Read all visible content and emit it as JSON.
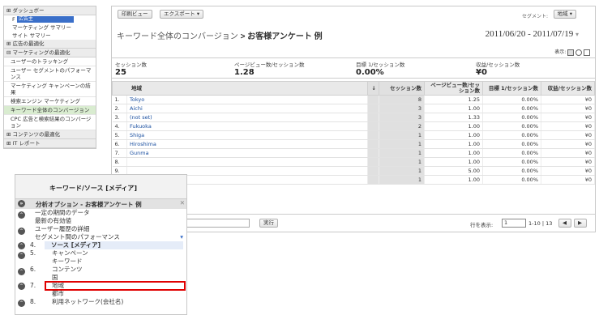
{
  "sidebar": {
    "dashboard": "ダッシュボー",
    "select_value": "広告主",
    "marketing_summary": "マーケティング サマリー",
    "site_summary": "サイト サマリー",
    "ad_optimization": "広告の最適化",
    "marketing_optimization": "マーケティングの最適化",
    "user_tracking": "ユーザーのトラッキング",
    "segment_performance": "ユーザー セグメントのパフォーマンス",
    "campaign_results": "マーケティング キャンペーンの結果",
    "search_marketing": "検索エンジン マーケティング",
    "keyword_conversion": "キーワード全体のコンバージョン",
    "cpc_comparison": "CPC 広告と検索結果のコンバージョン",
    "content_optimization": "コンテンツの最適化",
    "it_report": "IT レポート"
  },
  "toolbar": {
    "print": "印刷ビュー",
    "export": "エクスポート ▾",
    "segment_label": "セグメント:",
    "segment_value": "地域 ▾"
  },
  "title": {
    "part1": "キーワード全体のコンバージョン",
    "sep": " > ",
    "part2": "お客様アンケート 例"
  },
  "daterange": "2011/06/20 - 2011/07/19",
  "display_label": "表示:",
  "summary": [
    {
      "label": "セッション数",
      "value": "25"
    },
    {
      "label": "ページビュー数/セッション数",
      "value": "1.28"
    },
    {
      "label": "目標 1/セッション数",
      "value": "0.00%"
    },
    {
      "label": "収益/セッション数",
      "value": "¥0"
    }
  ],
  "table": {
    "headers": [
      "地域",
      "↓",
      "セッション数",
      "ページビュー数/セッション数",
      "目標 1/セッション数",
      "収益/セッション数"
    ],
    "rows": [
      [
        "1.",
        "Tokyo",
        "8",
        "1.25",
        "0.00%",
        "¥0"
      ],
      [
        "2.",
        "Aichi",
        "3",
        "1.00",
        "0.00%",
        "¥0"
      ],
      [
        "3.",
        "(not set)",
        "3",
        "1.33",
        "0.00%",
        "¥0"
      ],
      [
        "4.",
        "Fukuoka",
        "2",
        "1.00",
        "0.00%",
        "¥0"
      ],
      [
        "5.",
        "Shiga",
        "1",
        "1.00",
        "0.00%",
        "¥0"
      ],
      [
        "6.",
        "Hiroshima",
        "1",
        "1.00",
        "0.00%",
        "¥0"
      ],
      [
        "7.",
        "Gunma",
        "1",
        "1.00",
        "0.00%",
        "¥0"
      ],
      [
        "8.",
        "",
        "1",
        "1.00",
        "0.00%",
        "¥0"
      ],
      [
        "9.",
        "",
        "1",
        "5.00",
        "0.00%",
        "¥0"
      ],
      [
        "10.",
        "",
        "1",
        "1.00",
        "0.00%",
        "¥0"
      ]
    ]
  },
  "footer": {
    "run": "実行",
    "rows_label": "行を表示:",
    "rows_value": "1",
    "range": "1-10 | 13"
  },
  "popup": {
    "header": "キーワード/ソース [メディア]",
    "sub": "分析オプション - お客様アンケート 例",
    "items": [
      "一定の期間のデータ",
      "最新の有効値",
      "ユーザー履歴の詳細",
      "セグメント間のパフォーマンス"
    ],
    "n4": "4.",
    "source": "ソース [メディア]",
    "n5": "5.",
    "campaign": "キャンペーン",
    "keyword": "キーワード",
    "n6": "6.",
    "content": "コンテンツ",
    "country": "国",
    "n7": "7.",
    "region": "地域",
    "city": "都市",
    "n8": "8.",
    "network": "利用ネットワーク(会社名)"
  }
}
